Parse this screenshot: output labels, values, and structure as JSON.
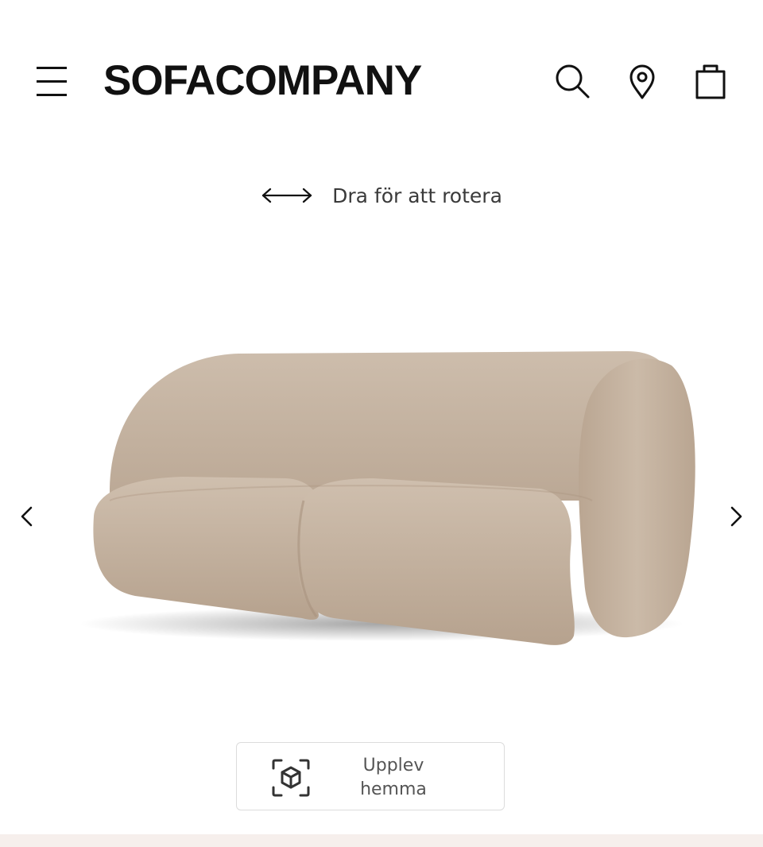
{
  "header": {
    "logo": "SOFACOMPANY",
    "icons": {
      "menu": "hamburger-menu-icon",
      "search": "search-icon",
      "location": "location-pin-icon",
      "cart": "shopping-bag-icon"
    }
  },
  "viewer": {
    "rotate_hint": "Dra för att rotera",
    "product_color": "#c9b8a6",
    "prev_icon": "chevron-left-icon",
    "next_icon": "chevron-right-icon"
  },
  "ar_button": {
    "line1": "Upplev",
    "line2": "hemma",
    "icon": "ar-cube-icon"
  },
  "colors": {
    "text": "#111111",
    "muted": "#555555",
    "border": "#dcdcdc",
    "strip": "#f6efec"
  }
}
